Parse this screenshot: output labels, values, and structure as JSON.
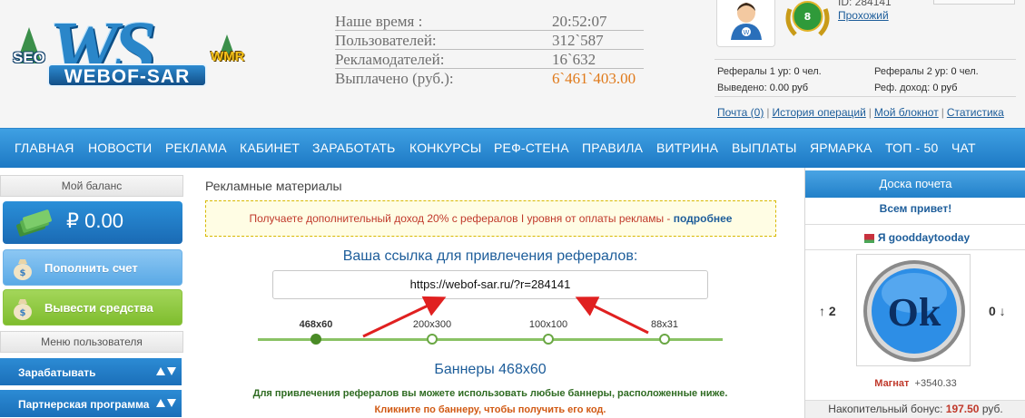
{
  "header": {
    "logo": {
      "seo": "SEO",
      "ws": "WS",
      "wmr": "WMR",
      "name": "WEBOF-SAR"
    },
    "stats": [
      {
        "label": "Наше время :",
        "value": "20:52:07"
      },
      {
        "label": "Пользователей:",
        "value": "312`587"
      },
      {
        "label": "Рекламодателей:",
        "value": "16`632"
      },
      {
        "label": "Выплачено (руб.):",
        "value": "6`461`403.00"
      }
    ],
    "user": {
      "id_label": "ID: 284141",
      "status": "Прохожий",
      "rank_level": "8"
    },
    "referrals": {
      "lvl1_label": "Рефералы 1 ур:",
      "lvl1_value": "0",
      "lvl1_unit": "чел.",
      "lvl2_label": "Рефералы 2 ур:",
      "lvl2_value": "0",
      "lvl2_unit": "чел.",
      "withdrawn_label": "Выведено:",
      "withdrawn_value": "0.00 руб",
      "ref_income_label": "Реф. доход:",
      "ref_income_value": "0 руб"
    },
    "links": [
      "Почта (0)",
      "История операций",
      "Мой блокнот",
      "Статистика"
    ]
  },
  "nav": [
    "ГЛАВНАЯ",
    "НОВОСТИ",
    "РЕКЛАМА",
    "КАБИНЕТ",
    "ЗАРАБОТАТЬ",
    "КОНКУРСЫ",
    "РЕФ-СТЕНА",
    "ПРАВИЛА",
    "ВИТРИНА",
    "ВЫПЛАТЫ",
    "ЯРМАРКА",
    "ТОП - 50",
    "ЧАТ"
  ],
  "left": {
    "balance_header": "Мой баланс",
    "balance": "₽ 0.00",
    "topup": "Пополнить счет",
    "withdraw": "Вывести средства",
    "menu_header": "Меню пользователя",
    "menu": [
      "Зарабатывать",
      "Партнерская программа"
    ]
  },
  "main": {
    "title": "Рекламные материалы",
    "notice": "Получаете дополнительный доход 20% с рефералов I уровня от оплаты рекламы - ",
    "notice_more": "подробнее",
    "ref_title": "Ваша ссылка для привлечения рефералов:",
    "ref_link": "https://webof-sar.ru/?r=284141",
    "sizes": [
      "468x60",
      "200x300",
      "100x100",
      "88x31"
    ],
    "selected_size": "468x60",
    "banners_title": "Баннеры 468x60",
    "banners_desc": "Для привлечения рефералов вы можете использовать любые баннеры, расположенные ниже.",
    "banners_click": "Кликните по баннеру, чтобы получить его код."
  },
  "right": {
    "header": "Доска почета",
    "greeting": "Всем привет!",
    "user": "Я gooddaytooday",
    "badge_text": "Ok",
    "votes_up": "↑ 2",
    "votes_down": "0 ↓",
    "magnat_label": "Магнат",
    "magnat_value": "+3540.33",
    "bonus_label": "Накопительный бонус:",
    "bonus_value": "197.50",
    "bonus_unit": "руб."
  },
  "colors": {
    "accent": "#1d79c4",
    "link": "#1d5d9a",
    "green": "#7fbd2e",
    "notice_bg": "#fffde4",
    "alert": "#c0392b"
  }
}
